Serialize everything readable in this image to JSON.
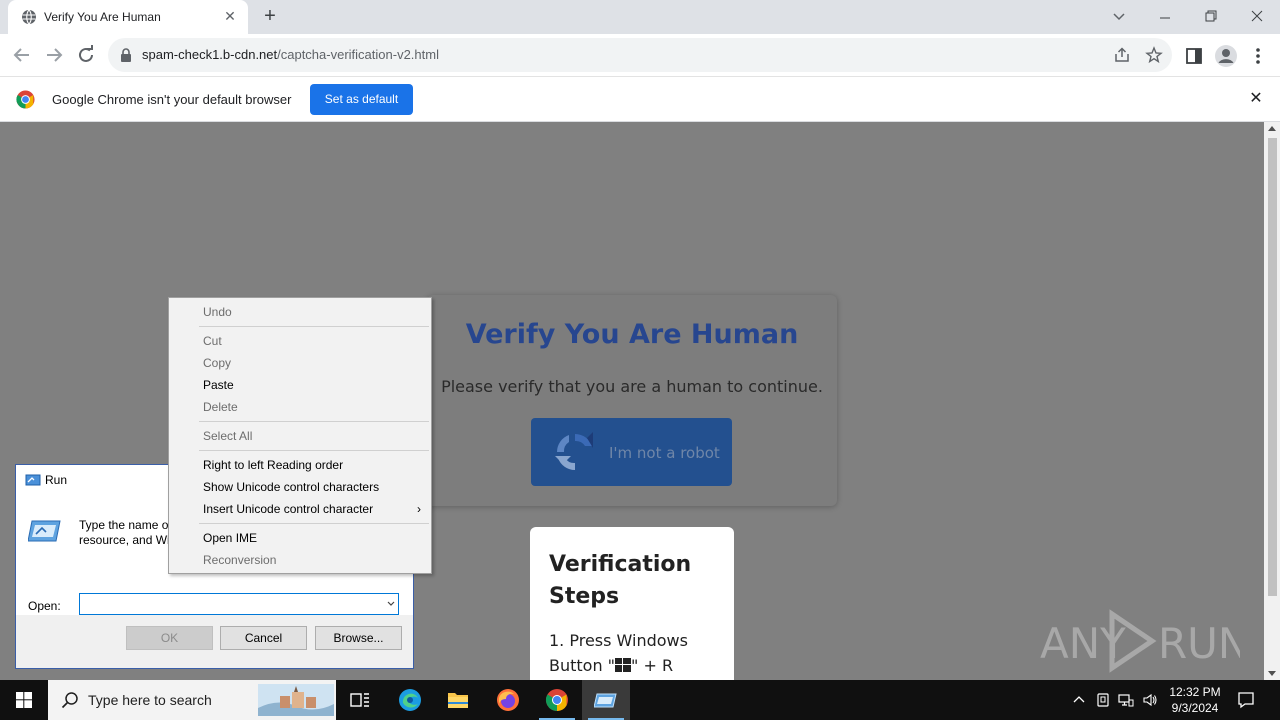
{
  "browser": {
    "tab_title": "Verify You Are Human",
    "tab_close": "✕",
    "new_tab": "+",
    "url_host": "spam-check1.b-cdn.net",
    "url_path": "/captcha-verification-v2.html",
    "infobar_text": "Google Chrome isn't your default browser",
    "set_default_label": "Set as default",
    "infobar_close": "✕"
  },
  "page": {
    "verify_title": "Verify You Are Human",
    "verify_subtitle": "Please verify that you are a human to continue.",
    "robot_button_label": "I'm not a robot",
    "steps_title": "Verification Steps",
    "steps_item_1_prefix": "1. Press Windows Button \"",
    "steps_item_1_suffix": "\" + R",
    "watermark_left": "ANY",
    "watermark_right": "RUN"
  },
  "run_dialog": {
    "title": "Run",
    "description_line1": "Type the name of",
    "description_line2": "resource, and Wi",
    "open_label": "Open:",
    "open_value": "",
    "ok_label": "OK",
    "cancel_label": "Cancel",
    "browse_label": "Browse..."
  },
  "context_menu": {
    "items": [
      {
        "label": "Undo",
        "enabled": false
      },
      {
        "label": "Cut",
        "enabled": false
      },
      {
        "label": "Copy",
        "enabled": false
      },
      {
        "label": "Paste",
        "enabled": true
      },
      {
        "label": "Delete",
        "enabled": false
      },
      {
        "label": "Select All",
        "enabled": false
      },
      {
        "label": "Right to left Reading order",
        "enabled": true
      },
      {
        "label": "Show Unicode control characters",
        "enabled": true
      },
      {
        "label": "Insert Unicode control character",
        "enabled": true
      },
      {
        "label": "Open IME",
        "enabled": true
      },
      {
        "label": "Reconversion",
        "enabled": false
      }
    ],
    "submenu_arrow": "›"
  },
  "taskbar": {
    "search_placeholder": "Type here to search",
    "time": "12:32 PM",
    "date": "9/3/2024"
  },
  "colors": {
    "accent_blue": "#1a73e8",
    "verify_title": "#27468f",
    "robot_button": "#23508f",
    "page_overlay": "#808080",
    "taskbar": "#101010"
  },
  "icons": {
    "tab_favicon": "globe-icon",
    "robot_button": "recaptcha-icon",
    "run_dialog": "run-icon"
  }
}
